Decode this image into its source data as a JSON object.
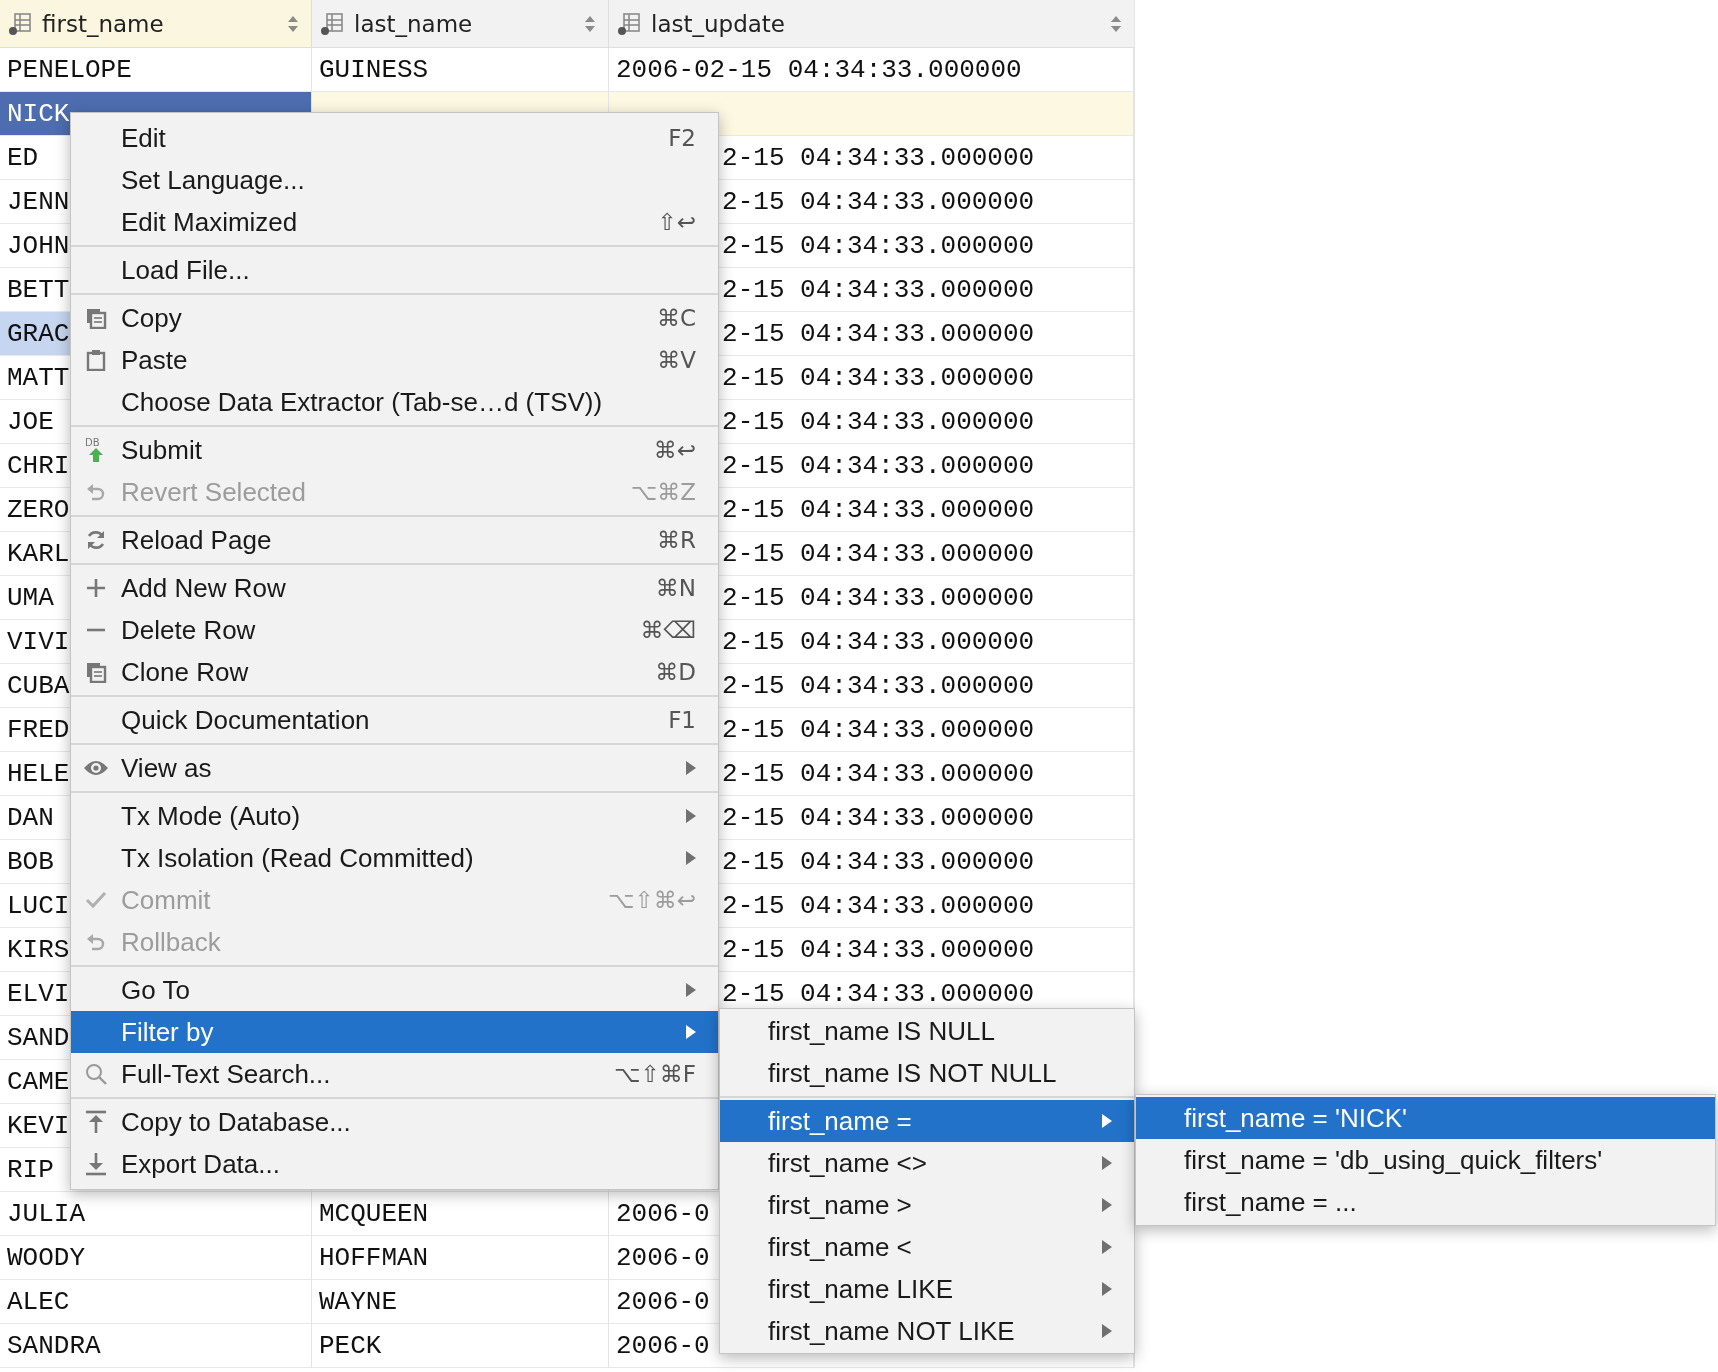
{
  "table": {
    "columns": [
      {
        "name": "first_name",
        "selected": true
      },
      {
        "name": "last_name",
        "selected": false
      },
      {
        "name": "last_update",
        "selected": false
      }
    ],
    "rows": [
      {
        "first_name": "PENELOPE",
        "last_name": "GUINESS",
        "last_update": "2006-02-15 04:34:33.000000",
        "cut_left": false,
        "selected": false,
        "highlighted": false
      },
      {
        "first_name": "NICK",
        "selected": true,
        "highlighted": false
      },
      {
        "first_name": "ED",
        "last_update": "2-15 04:34:33.000000",
        "cut_left": true,
        "selected": false,
        "highlighted": false
      },
      {
        "first_name": "JENN",
        "last_update": "2-15 04:34:33.000000",
        "cut_left": true,
        "selected": false,
        "highlighted": false
      },
      {
        "first_name": "JOHN",
        "last_update": "2-15 04:34:33.000000",
        "cut_left": true,
        "selected": false,
        "highlighted": false
      },
      {
        "first_name": "BETT",
        "last_update": "2-15 04:34:33.000000",
        "cut_left": true,
        "selected": false,
        "highlighted": false
      },
      {
        "first_name": "GRAC",
        "last_update": "2-15 04:34:33.000000",
        "cut_left": true,
        "selected": false,
        "highlighted": true
      },
      {
        "first_name": "MATT",
        "last_update": "2-15 04:34:33.000000",
        "cut_left": true,
        "selected": false,
        "highlighted": false
      },
      {
        "first_name": "JOE",
        "last_update": "2-15 04:34:33.000000",
        "cut_left": true,
        "selected": false,
        "highlighted": false
      },
      {
        "first_name": "CHRI",
        "last_update": "2-15 04:34:33.000000",
        "cut_left": true,
        "selected": false,
        "highlighted": false
      },
      {
        "first_name": "ZERO",
        "last_update": "2-15 04:34:33.000000",
        "cut_left": true,
        "selected": false,
        "highlighted": false
      },
      {
        "first_name": "KARL",
        "last_update": "2-15 04:34:33.000000",
        "cut_left": true,
        "selected": false,
        "highlighted": false
      },
      {
        "first_name": "UMA",
        "last_update": "2-15 04:34:33.000000",
        "cut_left": true,
        "selected": false,
        "highlighted": false
      },
      {
        "first_name": "VIVI",
        "last_update": "2-15 04:34:33.000000",
        "cut_left": true,
        "selected": false,
        "highlighted": false
      },
      {
        "first_name": "CUBA",
        "last_update": "2-15 04:34:33.000000",
        "cut_left": true,
        "selected": false,
        "highlighted": false
      },
      {
        "first_name": "FRED",
        "last_update": "2-15 04:34:33.000000",
        "cut_left": true,
        "selected": false,
        "highlighted": false
      },
      {
        "first_name": "HELE",
        "last_update": "2-15 04:34:33.000000",
        "cut_left": true,
        "selected": false,
        "highlighted": false
      },
      {
        "first_name": "DAN",
        "last_update": "2-15 04:34:33.000000",
        "cut_left": true,
        "selected": false,
        "highlighted": false
      },
      {
        "first_name": "BOB",
        "last_update": "2-15 04:34:33.000000",
        "cut_left": true,
        "selected": false,
        "highlighted": false
      },
      {
        "first_name": "LUCI",
        "last_update": "2-15 04:34:33.000000",
        "cut_left": true,
        "selected": false,
        "highlighted": false
      },
      {
        "first_name": "KIRS",
        "last_update": "2-15 04:34:33.000000",
        "cut_left": true,
        "selected": false,
        "highlighted": false
      },
      {
        "first_name": "ELVI",
        "last_update": "2-15 04:34:33.000000",
        "cut_left": true,
        "selected": false,
        "highlighted": false
      },
      {
        "first_name": "SAND",
        "selected": false,
        "highlighted": false
      },
      {
        "first_name": "CAME",
        "selected": false,
        "highlighted": false
      },
      {
        "first_name": "KEVI",
        "selected": false,
        "highlighted": false
      },
      {
        "first_name": "RIP",
        "selected": false,
        "highlighted": false
      },
      {
        "first_name": "JULIA",
        "last_name": "MCQUEEN",
        "last_update": "2006-0",
        "cut_left": false,
        "selected": false,
        "highlighted": false
      },
      {
        "first_name": "WOODY",
        "last_name": "HOFFMAN",
        "last_update": "2006-0",
        "cut_left": false,
        "selected": false,
        "highlighted": false
      },
      {
        "first_name": "ALEC",
        "last_name": "WAYNE",
        "last_update": "2006-0",
        "cut_left": false,
        "selected": false,
        "highlighted": false
      },
      {
        "first_name": "SANDRA",
        "last_name": "PECK",
        "last_update": "2006-0",
        "cut_left": false,
        "selected": false,
        "highlighted": false
      }
    ]
  },
  "context_menu": {
    "groups": [
      [
        {
          "label": "Edit",
          "shortcut": "F2",
          "kind": "plain",
          "disabled": false,
          "selected": false,
          "submenu": false
        },
        {
          "label": "Set Language...",
          "kind": "plain",
          "disabled": false,
          "selected": false,
          "submenu": false
        },
        {
          "label": "Edit Maximized",
          "shortcut": "⇧↩",
          "kind": "plain",
          "disabled": false,
          "selected": false,
          "submenu": false
        }
      ],
      [
        {
          "label": "Load File...",
          "kind": "plain",
          "disabled": false,
          "selected": false,
          "submenu": false
        }
      ],
      [
        {
          "label": "Copy",
          "shortcut": "⌘C",
          "kind": "copy",
          "disabled": false,
          "selected": false,
          "submenu": false
        },
        {
          "label": "Paste",
          "shortcut": "⌘V",
          "kind": "paste",
          "disabled": false,
          "selected": false,
          "submenu": false
        },
        {
          "label": "Choose Data Extractor (Tab-se…d (TSV))",
          "kind": "plain",
          "disabled": false,
          "selected": false,
          "submenu": false
        }
      ],
      [
        {
          "label": "Submit",
          "shortcut": "⌘↩",
          "kind": "submit",
          "badge": "DB",
          "disabled": false,
          "selected": false,
          "submenu": false
        },
        {
          "label": "Revert Selected",
          "shortcut": "⌥⌘Z",
          "kind": "undo",
          "disabled": true,
          "selected": false,
          "submenu": false
        }
      ],
      [
        {
          "label": "Reload Page",
          "shortcut": "⌘R",
          "kind": "reload",
          "disabled": false,
          "selected": false,
          "submenu": false
        }
      ],
      [
        {
          "label": "Add New Row",
          "shortcut": "⌘N",
          "kind": "add",
          "disabled": false,
          "selected": false,
          "submenu": false
        },
        {
          "label": "Delete Row",
          "shortcut": "⌘⌫",
          "kind": "remove",
          "disabled": false,
          "selected": false,
          "submenu": false
        },
        {
          "label": "Clone Row",
          "shortcut": "⌘D",
          "kind": "copy",
          "disabled": false,
          "selected": false,
          "submenu": false
        }
      ],
      [
        {
          "label": "Quick Documentation",
          "shortcut": "F1",
          "kind": "plain",
          "disabled": false,
          "selected": false,
          "submenu": false
        }
      ],
      [
        {
          "label": "View as",
          "kind": "eye",
          "disabled": false,
          "selected": false,
          "submenu": true
        }
      ],
      [
        {
          "label": "Tx Mode (Auto)",
          "kind": "plain",
          "disabled": false,
          "selected": false,
          "submenu": true
        },
        {
          "label": "Tx Isolation (Read Committed)",
          "kind": "plain",
          "disabled": false,
          "selected": false,
          "submenu": true
        },
        {
          "label": "Commit",
          "shortcut": "⌥⇧⌘↩",
          "kind": "check",
          "disabled": true,
          "selected": false,
          "submenu": false
        },
        {
          "label": "Rollback",
          "kind": "undo",
          "disabled": true,
          "selected": false,
          "submenu": false
        }
      ],
      [
        {
          "label": "Go To",
          "kind": "plain",
          "disabled": false,
          "selected": false,
          "submenu": true
        },
        {
          "label": "Filter by",
          "kind": "plain",
          "disabled": false,
          "selected": true,
          "submenu": true
        },
        {
          "label": "Full-Text Search...",
          "shortcut": "⌥⇧⌘F",
          "kind": "search",
          "disabled": false,
          "selected": false,
          "submenu": false
        }
      ],
      [
        {
          "label": "Copy to Database...",
          "kind": "upload",
          "disabled": false,
          "selected": false,
          "submenu": false
        },
        {
          "label": "Export Data...",
          "kind": "download",
          "disabled": false,
          "selected": false,
          "submenu": false
        }
      ]
    ]
  },
  "filter_submenu": {
    "groups": [
      [
        {
          "label": "first_name IS NULL",
          "selected": false,
          "submenu": false
        },
        {
          "label": "first_name IS NOT NULL",
          "selected": false,
          "submenu": false
        }
      ],
      [
        {
          "label": "first_name =",
          "selected": true,
          "submenu": true
        },
        {
          "label": "first_name <>",
          "selected": false,
          "submenu": true
        },
        {
          "label": "first_name >",
          "selected": false,
          "submenu": true
        },
        {
          "label": "first_name <",
          "selected": false,
          "submenu": true
        },
        {
          "label": "first_name LIKE",
          "selected": false,
          "submenu": true
        },
        {
          "label": "first_name NOT LIKE",
          "selected": false,
          "submenu": true
        }
      ]
    ]
  },
  "value_submenu": {
    "items": [
      {
        "label": "first_name = 'NICK'",
        "selected": true
      },
      {
        "label": "first_name = 'db_using_quick_filters'",
        "selected": false
      },
      {
        "label": "first_name = ...",
        "selected": false
      }
    ]
  }
}
